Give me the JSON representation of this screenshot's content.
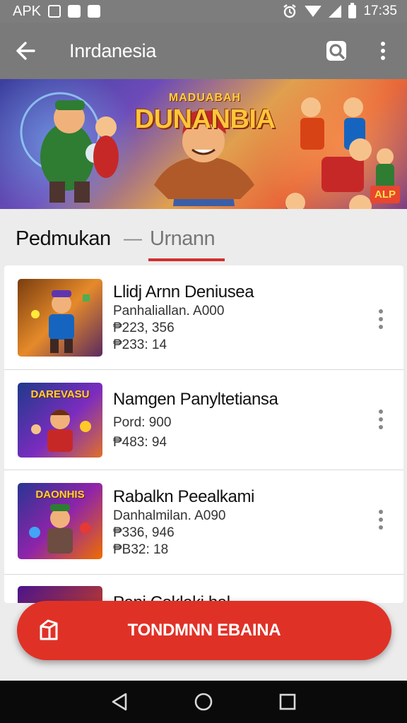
{
  "status_bar": {
    "left_label": "APK",
    "time": "17:35"
  },
  "app_bar": {
    "title": "Inrdanesia"
  },
  "banner": {
    "small_title": "MADUABAH",
    "big_title": "DUNANBIA",
    "badge": "ALP"
  },
  "tabs": {
    "primary": "Pedmukan",
    "separator": "—",
    "secondary": "Urnann"
  },
  "items": [
    {
      "title": "Llidj Arnn Deniusea",
      "line1": "Panhaliallan. A000",
      "line2": "₱223, 356",
      "line3": "₱233: 14",
      "thumb_label": ""
    },
    {
      "title": "Namgen Panyltetiansa",
      "line1": "Pord: 900",
      "line2": "₱483: 94",
      "line3": "",
      "thumb_label": "DAREVASU"
    },
    {
      "title": "Rabalkn Peealkami",
      "line1": "Danhalmilan. A090",
      "line2": "₱336, 946",
      "line3": "₱B32: 18",
      "thumb_label": "DAONHIS"
    },
    {
      "title": "Pani Coklaki,hal",
      "line1": "",
      "line2": "",
      "line3": "",
      "thumb_label": ""
    }
  ],
  "cta": {
    "label": "TONDMNN EBAINA"
  },
  "icons": {
    "back": "arrow-left-icon",
    "search": "search-icon",
    "more": "more-vert-icon",
    "cta": "box-icon",
    "nav_back": "triangle-back-icon",
    "nav_home": "circle-home-icon",
    "nav_recents": "square-recents-icon"
  },
  "colors": {
    "app_bar": "#7a7a7a",
    "accent": "#e03127",
    "tab_indicator": "#d32f2f"
  }
}
